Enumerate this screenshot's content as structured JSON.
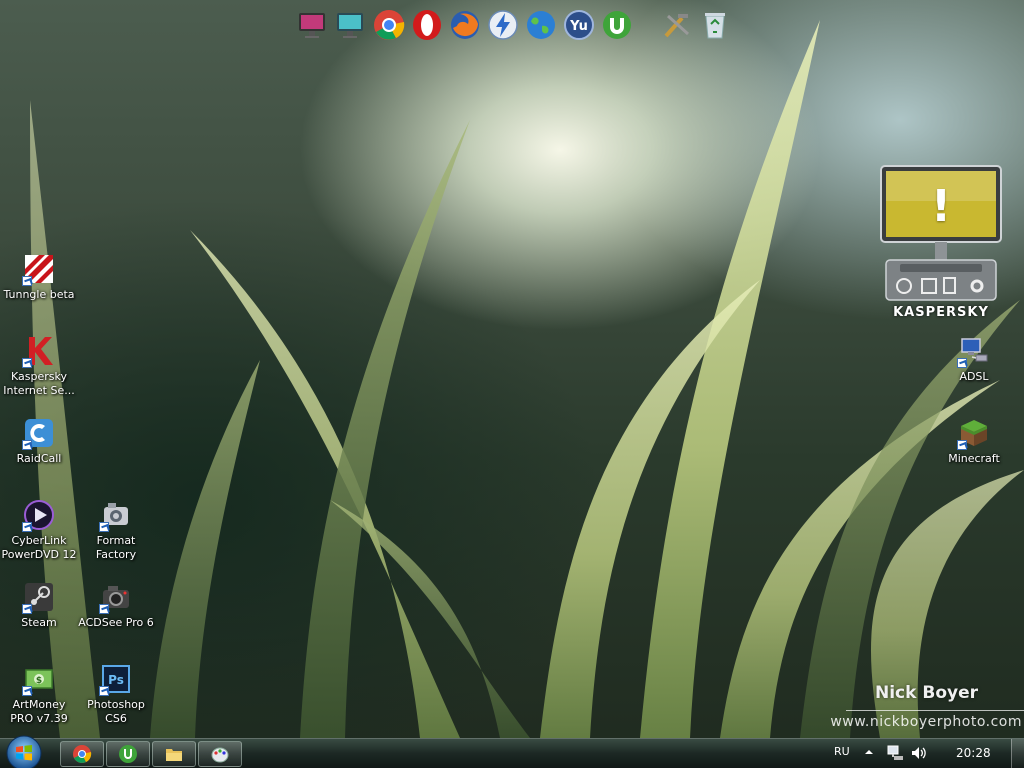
{
  "dock": {
    "icons": [
      "monitor-icon",
      "display-icon",
      "chrome-icon",
      "opera-icon",
      "firefox-icon",
      "flash-icon",
      "globe-icon",
      "yu-icon",
      "utorrent-icon",
      "tools-icon",
      "recycle-bin-icon"
    ]
  },
  "desktop": {
    "icons": [
      {
        "label": "Tunngle beta",
        "icon": "tunngle-icon"
      },
      {
        "label": "Kaspersky\nInternet Se...",
        "icon": "kaspersky-icon"
      },
      {
        "label": "RaidCall",
        "icon": "raidcall-icon"
      },
      {
        "label": "CyberLink\nPowerDVD 12",
        "icon": "powerdvd-icon"
      },
      {
        "label": "Format\nFactory",
        "icon": "format-factory-icon"
      },
      {
        "label": "Steam",
        "icon": "steam-icon"
      },
      {
        "label": "ACDSee Pro 6",
        "icon": "acdsee-icon"
      },
      {
        "label": "ArtMoney\nPRO v7.39",
        "icon": "artmoney-icon"
      },
      {
        "label": "Photoshop\nCS6",
        "icon": "photoshop-icon"
      },
      {
        "label": "ADSL",
        "icon": "network-connection-icon"
      },
      {
        "label": "Minecraft",
        "icon": "minecraft-icon"
      }
    ]
  },
  "gadget": {
    "brand": "KASPERSKY",
    "status_symbol": "!",
    "status_color": "#c9b830"
  },
  "watermark": {
    "name": "Nick Boyer",
    "url": "www.nickboyerphoto.com"
  },
  "taskbar": {
    "pinned": [
      "chrome-icon",
      "utorrent-icon",
      "explorer-icon",
      "paint-icon"
    ],
    "language": "RU",
    "clock": "20:28"
  }
}
